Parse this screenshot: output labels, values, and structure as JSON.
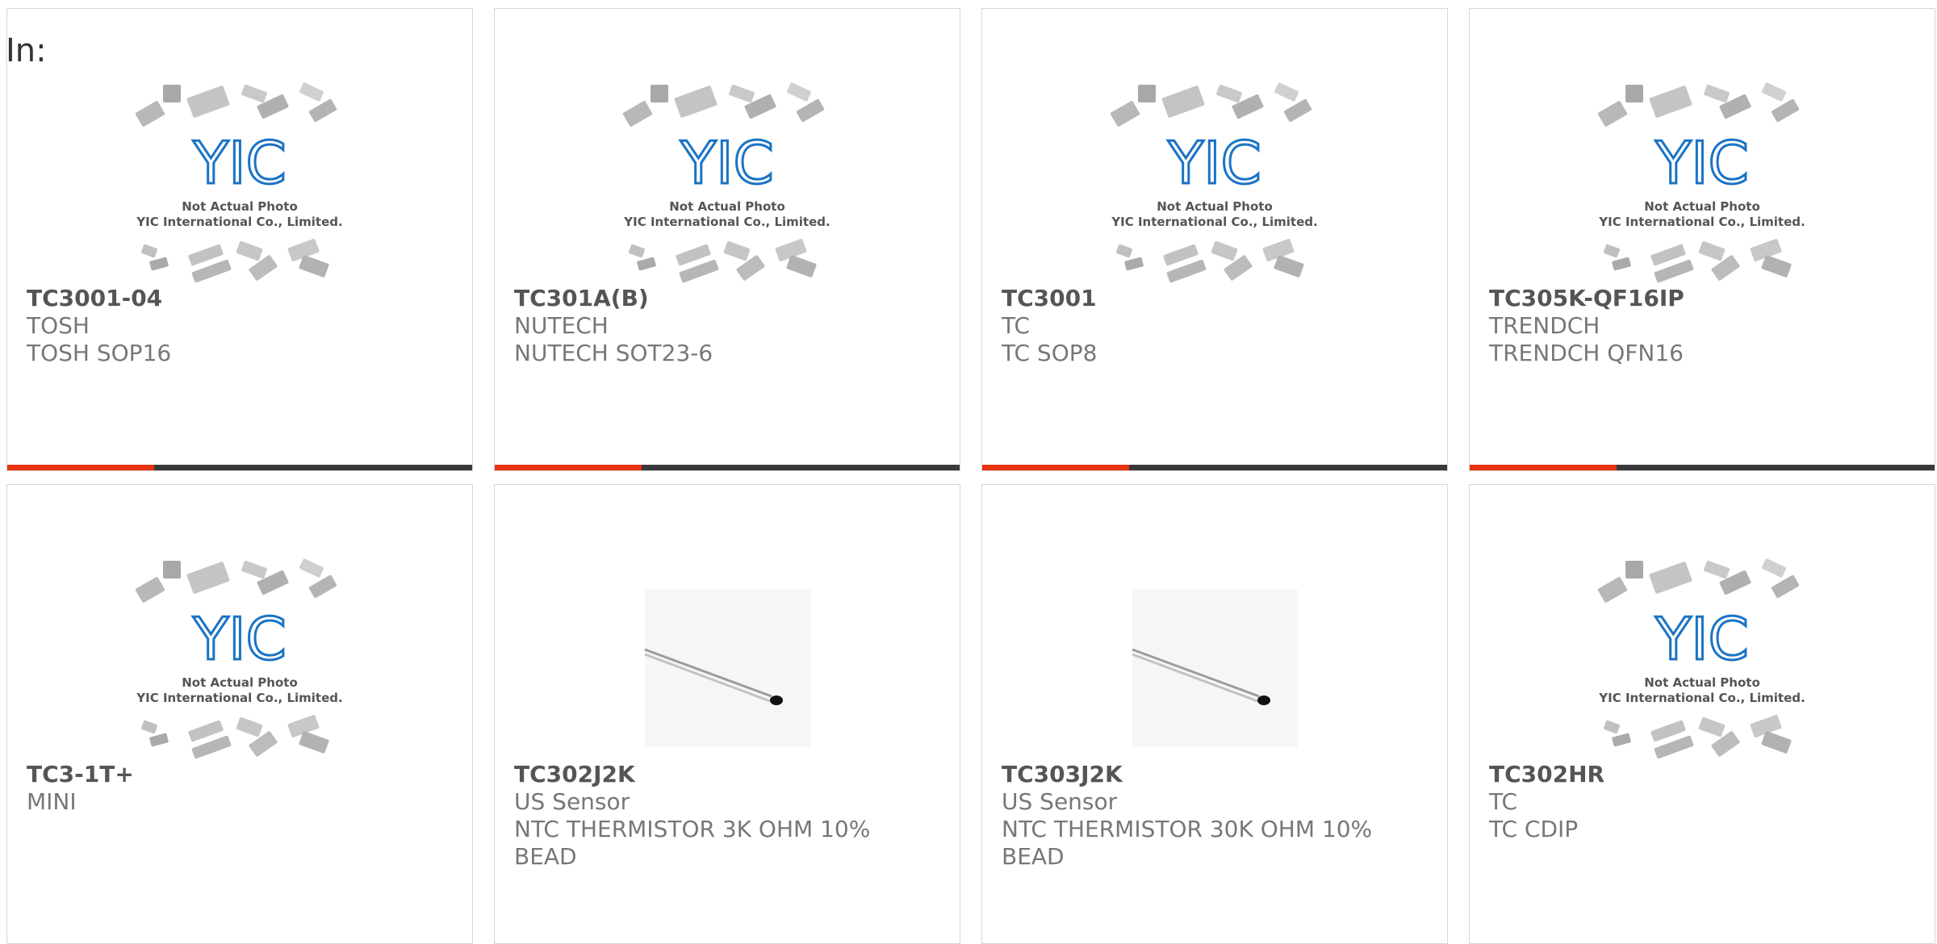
{
  "heading": "In:",
  "placeholder": {
    "logo_text": "YIC",
    "line1": "Not Actual Photo",
    "line2": "YIC International Co., Limited."
  },
  "colors": {
    "accent": "#e63312",
    "bar": "#3a3a3a",
    "logo": "#1a73c4"
  },
  "products": [
    {
      "part": "TC3001-04",
      "manufacturer": "TOSH",
      "description": "TOSH SOP16",
      "image": "placeholder"
    },
    {
      "part": "TC301A(B)",
      "manufacturer": "NUTECH",
      "description": "NUTECH SOT23-6",
      "image": "placeholder"
    },
    {
      "part": "TC3001",
      "manufacturer": "TC",
      "description": "TC SOP8",
      "image": "placeholder"
    },
    {
      "part": "TC305K-QF16IP",
      "manufacturer": "TRENDCH",
      "description": "TRENDCH QFN16",
      "image": "placeholder"
    },
    {
      "part": "TC3-1T+",
      "manufacturer": "MINI",
      "description": "",
      "image": "placeholder"
    },
    {
      "part": "TC302J2K",
      "manufacturer": "US Sensor",
      "description": "NTC THERMISTOR 3K OHM 10% BEAD",
      "image": "thermistor"
    },
    {
      "part": "TC303J2K",
      "manufacturer": "US Sensor",
      "description": "NTC THERMISTOR 30K OHM 10% BEAD",
      "image": "thermistor"
    },
    {
      "part": "TC302HR",
      "manufacturer": "TC",
      "description": "TC CDIP",
      "image": "placeholder"
    }
  ]
}
